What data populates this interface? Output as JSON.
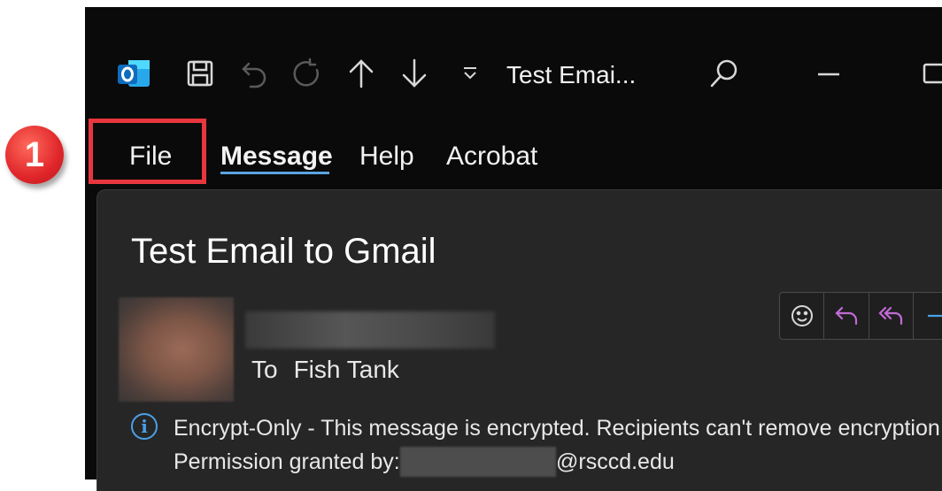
{
  "titlebar": {
    "title": "Test Emai...",
    "app_icon": "outlook-icon",
    "icons": [
      "save-icon",
      "undo-icon",
      "redo-icon",
      "up-arrow-icon",
      "down-arrow-icon",
      "customize-toolbar-icon",
      "search-icon",
      "minimize-icon",
      "maximize-icon"
    ]
  },
  "menu": {
    "file": "File",
    "message": "Message",
    "help": "Help",
    "acrobat": "Acrobat"
  },
  "annotation": {
    "step_number": "1",
    "highlight_color": "#e8363e"
  },
  "email": {
    "subject": "Test Email to Gmail",
    "to_label": "To",
    "to_name": "Fish Tank",
    "encryption_notice": "Encrypt-Only - This message is encrypted. Recipients can't remove encryption.",
    "permission_label": "Permission granted by:",
    "permission_domain": "@rsccd.edu"
  },
  "actions": [
    "emoji-icon",
    "reply-icon",
    "reply-all-icon"
  ],
  "colors": {
    "accent": "#5ba3e0",
    "reply": "#c26ad6",
    "info": "#4aa0e8",
    "outlook_blue": "#0f6cbd"
  }
}
